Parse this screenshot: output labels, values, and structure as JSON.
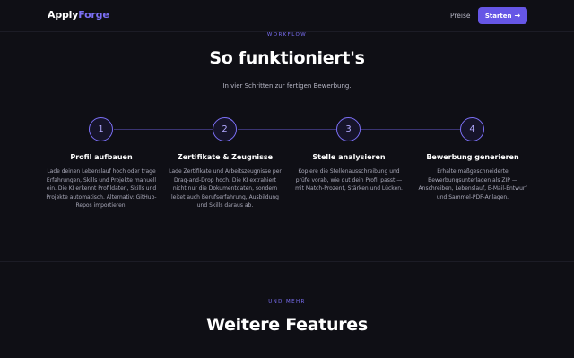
{
  "nav": {
    "logo_part1": "Apply",
    "logo_part2": "Forge",
    "link_prices": "Preise",
    "cta_label": "Starten",
    "cta_icon": "arrow-right-icon"
  },
  "workflow": {
    "eyebrow": "WORKFLOW",
    "title": "So funktioniert's",
    "subtitle": "In vier Schritten zur fertigen Bewerbung.",
    "steps": [
      {
        "number": "1",
        "title": "Profil aufbauen",
        "text": "Lade deinen Lebenslauf hoch oder trage Erfahrungen, Skills und Projekte manuell ein. Die KI erkennt Profildaten, Skills und Projekte automatisch. Alternativ: GitHub-Repos importieren."
      },
      {
        "number": "2",
        "title": "Zertifikate & Zeugnisse",
        "text": "Lade Zertifikate und Arbeitszeugnisse per Drag-and-Drop hoch. Die KI extrahiert nicht nur die Dokumentdaten, sondern leitet auch Berufserfahrung, Ausbildung und Skills daraus ab."
      },
      {
        "number": "3",
        "title": "Stelle analysieren",
        "text": "Kopiere die Stellenausschreibung und prüfe vorab, wie gut dein Profil passt — mit Match-Prozent, Stärken und Lücken."
      },
      {
        "number": "4",
        "title": "Bewerbung generieren",
        "text": "Erhalte maßgeschneiderte Bewerbungsunterlagen als ZIP — Anschreiben, Lebenslauf, E-Mail-Entwurf und Sammel-PDF-Anlagen."
      }
    ]
  },
  "features": {
    "eyebrow": "UND MEHR",
    "title": "Weitere Features"
  },
  "colors": {
    "background": "#0f0f15",
    "accent": "#7b6ff5",
    "button": "#6656e6"
  }
}
